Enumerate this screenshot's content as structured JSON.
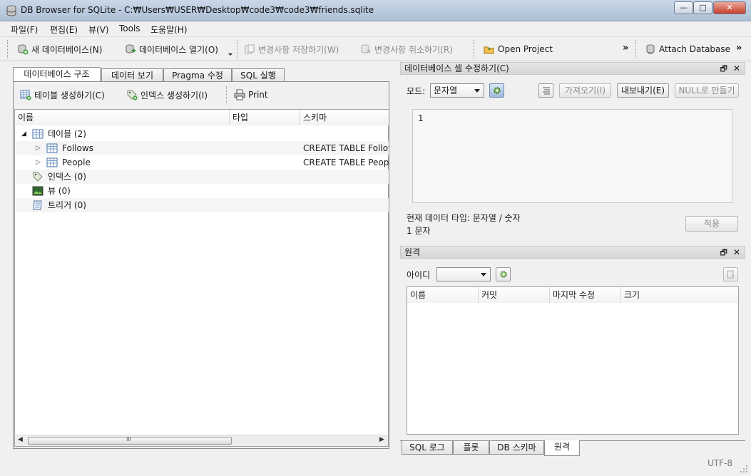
{
  "window": {
    "title": "DB Browser for SQLite - C:₩Users₩USER₩Desktop₩code3₩code3₩friends.sqlite",
    "minimize": "—",
    "maximize": "□",
    "close": "✕"
  },
  "menu": [
    "파일(F)",
    "편집(E)",
    "뷰(V)",
    "Tools",
    "도움말(H)"
  ],
  "toolbar": {
    "new_db": "새 데이터베이스(N)",
    "open_db": "데이터베이스 열기(O)",
    "write_changes": "변경사항 저장하기(W)",
    "revert_changes": "변경사항 취소하기(R)",
    "open_project": "Open Project",
    "more1": "»",
    "attach_db": "Attach Database",
    "more2": "»"
  },
  "main_tabs": [
    "데이터베이스 구조",
    "데이터 보기",
    "Pragma 수정",
    "SQL 실행"
  ],
  "structure": {
    "create_table": "테이블 생성하기(C)",
    "create_index": "인덱스 생성하기(I)",
    "print": "Print",
    "columns": [
      "이름",
      "타입",
      "스키마"
    ],
    "rows": [
      {
        "name": "테이블 (2)",
        "schema": ""
      },
      {
        "name": "Follows",
        "schema": "CREATE TABLE Follows"
      },
      {
        "name": "People",
        "schema": "CREATE TABLE People"
      },
      {
        "name": "인덱스 (0)",
        "schema": ""
      },
      {
        "name": "뷰 (0)",
        "schema": ""
      },
      {
        "name": "트리거 (0)",
        "schema": ""
      }
    ],
    "hscroll_grip": "III"
  },
  "edit_cell": {
    "title": "데이터베이스 셀 수정하기(C)",
    "mode_label": "모드:",
    "mode_value": "문자열",
    "import": "가져오기(I)",
    "export": "내보내기(E)",
    "set_null": "NULL로 만들기",
    "content": "1",
    "type_info": "현재 데이터 타입: 문자열 / 숫자",
    "size_info": "1 문자",
    "apply": "적용"
  },
  "remote": {
    "title": "원격",
    "id_label": "아이디",
    "id_value": "",
    "columns": [
      "이름",
      "커밋",
      "마지막 수정",
      "크기"
    ]
  },
  "bottom_tabs": [
    "SQL 로그",
    "플롯",
    "DB 스키마",
    "원격"
  ],
  "status": {
    "encoding": "UTF-8"
  },
  "dock_buttons": {
    "float": "🗗",
    "close": "✕"
  }
}
